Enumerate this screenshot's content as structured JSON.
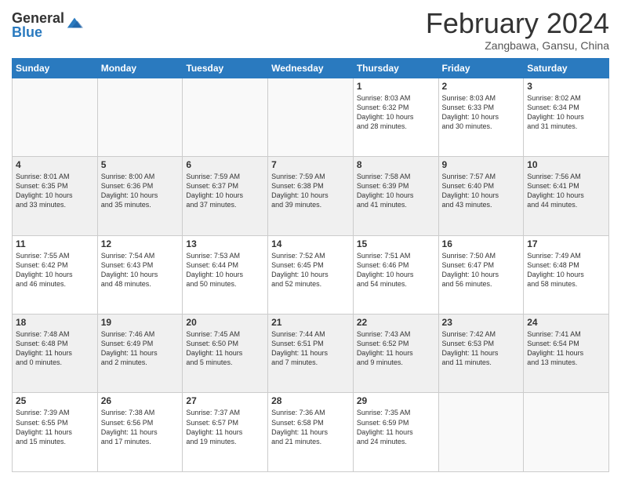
{
  "logo": {
    "general": "General",
    "blue": "Blue"
  },
  "title": "February 2024",
  "subtitle": "Zangbawa, Gansu, China",
  "days_of_week": [
    "Sunday",
    "Monday",
    "Tuesday",
    "Wednesday",
    "Thursday",
    "Friday",
    "Saturday"
  ],
  "weeks": [
    [
      {
        "day": "",
        "info": ""
      },
      {
        "day": "",
        "info": ""
      },
      {
        "day": "",
        "info": ""
      },
      {
        "day": "",
        "info": ""
      },
      {
        "day": "1",
        "info": "Sunrise: 8:03 AM\nSunset: 6:32 PM\nDaylight: 10 hours\nand 28 minutes."
      },
      {
        "day": "2",
        "info": "Sunrise: 8:03 AM\nSunset: 6:33 PM\nDaylight: 10 hours\nand 30 minutes."
      },
      {
        "day": "3",
        "info": "Sunrise: 8:02 AM\nSunset: 6:34 PM\nDaylight: 10 hours\nand 31 minutes."
      }
    ],
    [
      {
        "day": "4",
        "info": "Sunrise: 8:01 AM\nSunset: 6:35 PM\nDaylight: 10 hours\nand 33 minutes."
      },
      {
        "day": "5",
        "info": "Sunrise: 8:00 AM\nSunset: 6:36 PM\nDaylight: 10 hours\nand 35 minutes."
      },
      {
        "day": "6",
        "info": "Sunrise: 7:59 AM\nSunset: 6:37 PM\nDaylight: 10 hours\nand 37 minutes."
      },
      {
        "day": "7",
        "info": "Sunrise: 7:59 AM\nSunset: 6:38 PM\nDaylight: 10 hours\nand 39 minutes."
      },
      {
        "day": "8",
        "info": "Sunrise: 7:58 AM\nSunset: 6:39 PM\nDaylight: 10 hours\nand 41 minutes."
      },
      {
        "day": "9",
        "info": "Sunrise: 7:57 AM\nSunset: 6:40 PM\nDaylight: 10 hours\nand 43 minutes."
      },
      {
        "day": "10",
        "info": "Sunrise: 7:56 AM\nSunset: 6:41 PM\nDaylight: 10 hours\nand 44 minutes."
      }
    ],
    [
      {
        "day": "11",
        "info": "Sunrise: 7:55 AM\nSunset: 6:42 PM\nDaylight: 10 hours\nand 46 minutes."
      },
      {
        "day": "12",
        "info": "Sunrise: 7:54 AM\nSunset: 6:43 PM\nDaylight: 10 hours\nand 48 minutes."
      },
      {
        "day": "13",
        "info": "Sunrise: 7:53 AM\nSunset: 6:44 PM\nDaylight: 10 hours\nand 50 minutes."
      },
      {
        "day": "14",
        "info": "Sunrise: 7:52 AM\nSunset: 6:45 PM\nDaylight: 10 hours\nand 52 minutes."
      },
      {
        "day": "15",
        "info": "Sunrise: 7:51 AM\nSunset: 6:46 PM\nDaylight: 10 hours\nand 54 minutes."
      },
      {
        "day": "16",
        "info": "Sunrise: 7:50 AM\nSunset: 6:47 PM\nDaylight: 10 hours\nand 56 minutes."
      },
      {
        "day": "17",
        "info": "Sunrise: 7:49 AM\nSunset: 6:48 PM\nDaylight: 10 hours\nand 58 minutes."
      }
    ],
    [
      {
        "day": "18",
        "info": "Sunrise: 7:48 AM\nSunset: 6:48 PM\nDaylight: 11 hours\nand 0 minutes."
      },
      {
        "day": "19",
        "info": "Sunrise: 7:46 AM\nSunset: 6:49 PM\nDaylight: 11 hours\nand 2 minutes."
      },
      {
        "day": "20",
        "info": "Sunrise: 7:45 AM\nSunset: 6:50 PM\nDaylight: 11 hours\nand 5 minutes."
      },
      {
        "day": "21",
        "info": "Sunrise: 7:44 AM\nSunset: 6:51 PM\nDaylight: 11 hours\nand 7 minutes."
      },
      {
        "day": "22",
        "info": "Sunrise: 7:43 AM\nSunset: 6:52 PM\nDaylight: 11 hours\nand 9 minutes."
      },
      {
        "day": "23",
        "info": "Sunrise: 7:42 AM\nSunset: 6:53 PM\nDaylight: 11 hours\nand 11 minutes."
      },
      {
        "day": "24",
        "info": "Sunrise: 7:41 AM\nSunset: 6:54 PM\nDaylight: 11 hours\nand 13 minutes."
      }
    ],
    [
      {
        "day": "25",
        "info": "Sunrise: 7:39 AM\nSunset: 6:55 PM\nDaylight: 11 hours\nand 15 minutes."
      },
      {
        "day": "26",
        "info": "Sunrise: 7:38 AM\nSunset: 6:56 PM\nDaylight: 11 hours\nand 17 minutes."
      },
      {
        "day": "27",
        "info": "Sunrise: 7:37 AM\nSunset: 6:57 PM\nDaylight: 11 hours\nand 19 minutes."
      },
      {
        "day": "28",
        "info": "Sunrise: 7:36 AM\nSunset: 6:58 PM\nDaylight: 11 hours\nand 21 minutes."
      },
      {
        "day": "29",
        "info": "Sunrise: 7:35 AM\nSunset: 6:59 PM\nDaylight: 11 hours\nand 24 minutes."
      },
      {
        "day": "",
        "info": ""
      },
      {
        "day": "",
        "info": ""
      }
    ]
  ]
}
